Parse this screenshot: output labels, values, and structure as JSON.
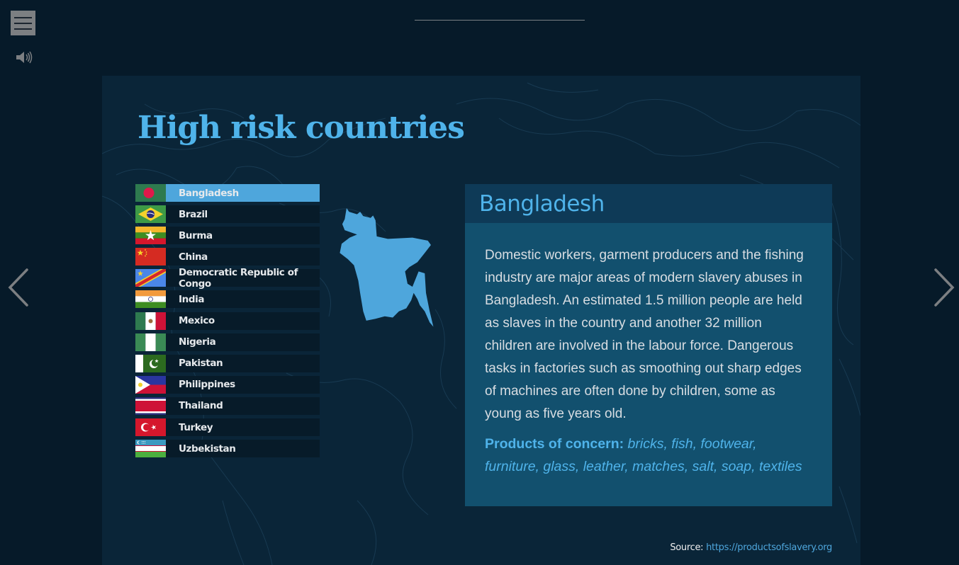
{
  "header": {
    "menu_icon": "hamburger-menu-icon",
    "audio_icon": "speaker-volume-icon"
  },
  "navigation": {
    "prev_icon": "chevron-left-icon",
    "next_icon": "chevron-right-icon"
  },
  "slide": {
    "title": "High risk countries",
    "countries": [
      {
        "name": "Bangladesh",
        "flag": "bangladesh",
        "active": true
      },
      {
        "name": "Brazil",
        "flag": "brazil",
        "active": false
      },
      {
        "name": "Burma",
        "flag": "burma",
        "active": false
      },
      {
        "name": "China",
        "flag": "china",
        "active": false
      },
      {
        "name": "Democratic Republic of Congo",
        "flag": "drc",
        "active": false
      },
      {
        "name": "India",
        "flag": "india",
        "active": false
      },
      {
        "name": "Mexico",
        "flag": "mexico",
        "active": false
      },
      {
        "name": "Nigeria",
        "flag": "nigeria",
        "active": false
      },
      {
        "name": "Pakistan",
        "flag": "pakistan",
        "active": false
      },
      {
        "name": "Philippines",
        "flag": "philippines",
        "active": false
      },
      {
        "name": "Thailand",
        "flag": "thailand",
        "active": false
      },
      {
        "name": "Turkey",
        "flag": "turkey",
        "active": false
      },
      {
        "name": "Uzbekistan",
        "flag": "uzbekistan",
        "active": false
      }
    ],
    "info": {
      "country": "Bangladesh",
      "description": "Domestic workers, garment producers and the fishing industry are major areas of modern slavery abuses in Bangladesh. An estimated 1.5 million people are held as slaves in the country and another 32 million children are involved in the labour force. Dangerous tasks in factories such as smoothing out sharp edges of machines are often done by children, some as young as five years old.",
      "products_label": "Products of concern:",
      "products": "bricks, fish, footwear, furniture, glass, leather, matches, salt, soap, textiles"
    },
    "source": {
      "label": "Source:",
      "link": "https://productsofslavery.org"
    }
  },
  "colors": {
    "accent": "#4fb3ea",
    "active_item": "#4ea6dc",
    "panel": "#12506e",
    "panel_header": "#0e3a57",
    "background": "#061a29",
    "slide_bg": "#0a2538"
  }
}
